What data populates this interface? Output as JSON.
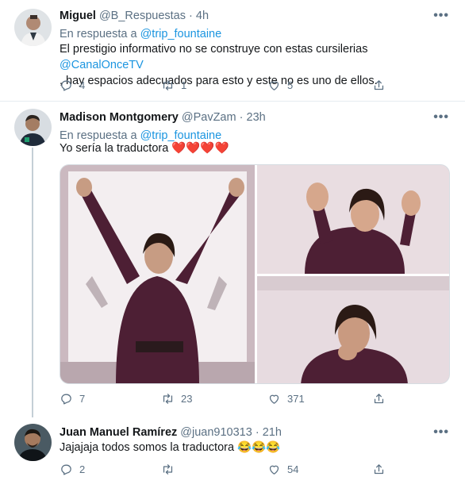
{
  "tweets": [
    {
      "name": "Miguel",
      "handle": "@B_Respuestas",
      "time": "4h",
      "reply_prefix": "En respuesta a",
      "reply_to": "@trip_fountaine",
      "text_part1": "El prestigio informativo no se construye con estas cursilerias ",
      "text_mention": "@CanalOnceTV",
      "text_part2": ", hay espacios adecuados para esto y este no es uno de ellos.",
      "replies": "4",
      "retweets": "1",
      "likes": "5"
    },
    {
      "name": "Madison Montgomery",
      "handle": "@PavZam",
      "time": "23h",
      "reply_prefix": "En respuesta a",
      "reply_to": "@trip_fountaine",
      "text": "Yo sería la traductora",
      "emojis": "❤️❤️❤️❤️",
      "replies": "7",
      "retweets": "23",
      "likes": "371"
    },
    {
      "name": "Juan Manuel Ramírez",
      "handle": "@juan910313",
      "time": "21h",
      "text": "Jajajaja todos somos la traductora",
      "emojis": "😂😂😂",
      "replies": "2",
      "retweets": "",
      "likes": "54"
    }
  ],
  "ui": {
    "more": "•••",
    "dot": "·"
  },
  "colors": {
    "link": "#1b95e0",
    "muted": "#5b7083",
    "heart": "#e0245e"
  },
  "icons": [
    "reply-icon",
    "retweet-icon",
    "like-icon",
    "share-icon",
    "more-icon"
  ]
}
